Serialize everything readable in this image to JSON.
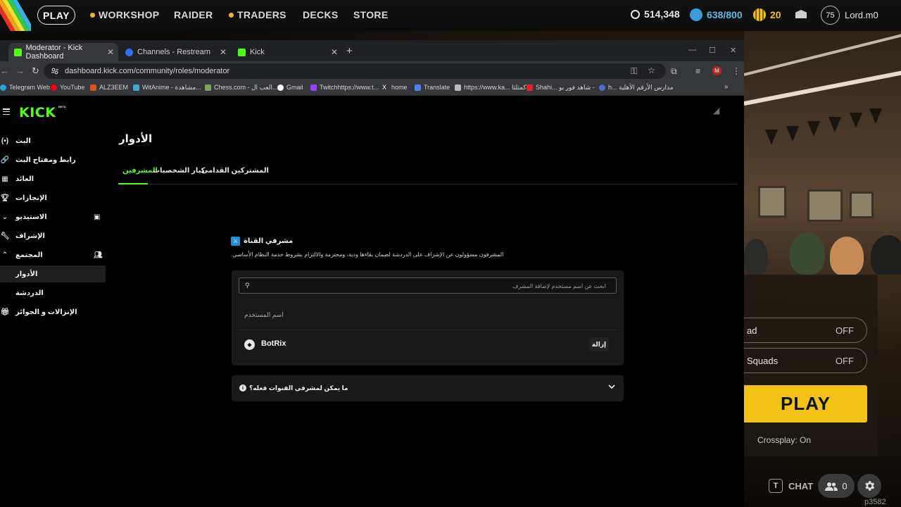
{
  "game": {
    "nav": {
      "play": "PLAY",
      "workshop": "WORKSHOP",
      "raider": "RAIDER",
      "traders": "TRADERS",
      "decks": "DECKS",
      "store": "STORE"
    },
    "currency": {
      "coins": "514,348",
      "cred": "638/800",
      "tokens": "20"
    },
    "player": {
      "level": "75",
      "name": "Lord.m0"
    },
    "options": [
      {
        "label": "ad",
        "value": "OFF"
      },
      {
        "label": "Squads",
        "value": "OFF"
      }
    ],
    "play_button": "PLAY",
    "crossplay": "Crossplay: On",
    "chat_key": "T",
    "chat_label": "CHAT",
    "friends_count": "0",
    "build_id": "p3582"
  },
  "browser": {
    "tabs": [
      {
        "title": "Moderator - Kick Dashboard",
        "favicon_color": "#53fc18",
        "active": true
      },
      {
        "title": "Channels - Restream",
        "favicon_color": "#2f6ff0",
        "active": false
      },
      {
        "title": "Kick",
        "favicon_color": "#53fc18",
        "active": false
      }
    ],
    "url": "dashboard.kick.com/community/roles/moderator",
    "bookmarks": [
      {
        "label": "Telegram Web",
        "color": "#2aa3e0"
      },
      {
        "label": "YouTube",
        "color": "#ff0000"
      },
      {
        "label": "ALZ3EEM",
        "color": "#d9531e"
      },
      {
        "label": "WitAnime - مشاهدة...",
        "color": "#3fa7d6"
      },
      {
        "label": "Chess.com - العب ال...",
        "color": "#7fa650"
      },
      {
        "label": "Gmail",
        "color": "#ffffff"
      },
      {
        "label": "Twitchhttps://www.t...",
        "color": "#9146ff"
      },
      {
        "label": "home",
        "color": "#ffffff"
      },
      {
        "label": "Translate",
        "color": "#4285f4"
      },
      {
        "label": "https://www.ka... كمثلثا",
        "color": "#bbbbbb"
      },
      {
        "label": "Shahi... شاهد فور يو -",
        "color": "#e5202e"
      },
      {
        "label": "h... مدارس الأرقم الأهلية",
        "color": "#4a6ed1"
      }
    ]
  },
  "kick": {
    "logo": "KICK",
    "beta": "BETA",
    "sidebar": [
      {
        "label": "البث",
        "icon": "broadcast-icon"
      },
      {
        "label": "رابط ومفتاح البث",
        "icon": "link-icon"
      },
      {
        "label": "العائد",
        "icon": "revenue-icon"
      },
      {
        "label": "الإنجازات",
        "icon": "trophy-icon"
      },
      {
        "label": "الاستيديو",
        "icon": "chevron-down-icon"
      },
      {
        "label": "الإشراف",
        "icon": "wrench-icon"
      },
      {
        "label": "المجتمع",
        "icon": "chevron-up-icon"
      },
      {
        "label": "الأدوار",
        "icon": ""
      },
      {
        "label": "الدردشة",
        "icon": ""
      },
      {
        "label": "الإنزالات و الجوائز",
        "icon": "gift-icon"
      }
    ],
    "page_title": "الأدوار",
    "role_tabs": [
      "المشرفين",
      "كبار الشخصيات",
      "المشتركين القدامى"
    ],
    "section": {
      "title": "مشرفي القناة",
      "description": "المشرفون مسؤولون عن الإشراف على الدردشة لضمان بقاءها ودية، ومحترمة والالتزام بشروط خدمة النظام الأساسي."
    },
    "search_placeholder": "ابحث عن اسم مستخدم لإضافة المشرف",
    "column_header": "اسم المستخدم",
    "moderators": [
      {
        "name": "BotRix",
        "action": "إزالة"
      }
    ],
    "faq_question": "ما يمكن لمشرفي القنوات فعله؟"
  }
}
